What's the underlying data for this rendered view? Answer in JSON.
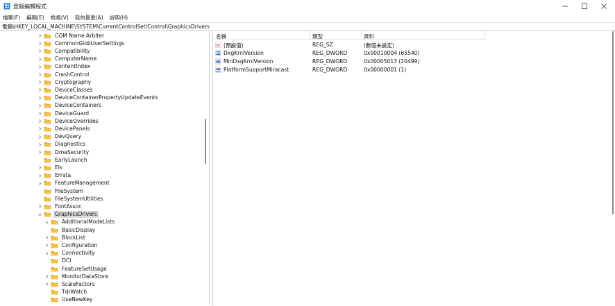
{
  "window": {
    "title": "登錄編輯程式"
  },
  "menu": [
    "檔案(F)",
    "編輯(E)",
    "檢視(V)",
    "我的最愛(A)",
    "說明(H)"
  ],
  "address": "電腦\\HKEY_LOCAL_MACHINE\\SYSTEM\\CurrentControlSet\\Control\\GraphicsDrivers",
  "tree": [
    {
      "label": "COM Name Arbiter",
      "level": 0,
      "expandable": true
    },
    {
      "label": "CommonGlobUserSettings",
      "level": 0,
      "expandable": true
    },
    {
      "label": "Compatibility",
      "level": 0,
      "expandable": true
    },
    {
      "label": "ComputerName",
      "level": 0,
      "expandable": true
    },
    {
      "label": "ContentIndex",
      "level": 0,
      "expandable": true
    },
    {
      "label": "CrashControl",
      "level": 0,
      "expandable": true
    },
    {
      "label": "Cryptography",
      "level": 0,
      "expandable": true
    },
    {
      "label": "DeviceClasses",
      "level": 0,
      "expandable": true
    },
    {
      "label": "DeviceContainerPropertyUpdateEvents",
      "level": 0,
      "expandable": true
    },
    {
      "label": "DeviceContainers",
      "level": 0,
      "expandable": true
    },
    {
      "label": "DeviceGuard",
      "level": 0,
      "expandable": true
    },
    {
      "label": "DeviceOverrides",
      "level": 0,
      "expandable": true
    },
    {
      "label": "DevicePanels",
      "level": 0,
      "expandable": true
    },
    {
      "label": "DevQuery",
      "level": 0,
      "expandable": true
    },
    {
      "label": "Diagnostics",
      "level": 0,
      "expandable": true
    },
    {
      "label": "DmaSecurity",
      "level": 0,
      "expandable": true
    },
    {
      "label": "EarlyLaunch",
      "level": 0,
      "expandable": false
    },
    {
      "label": "Els",
      "level": 0,
      "expandable": true
    },
    {
      "label": "Errata",
      "level": 0,
      "expandable": true
    },
    {
      "label": "FeatureManagement",
      "level": 0,
      "expandable": true
    },
    {
      "label": "FileSystem",
      "level": 0,
      "expandable": false
    },
    {
      "label": "FileSystemUtilities",
      "level": 0,
      "expandable": false
    },
    {
      "label": "FontAssoc",
      "level": 0,
      "expandable": true
    },
    {
      "label": "GraphicsDrivers",
      "level": 0,
      "expandable": true,
      "expanded": true,
      "selected": true
    },
    {
      "label": "AdditionalModeLists",
      "level": 1,
      "expandable": true
    },
    {
      "label": "BasicDisplay",
      "level": 1,
      "expandable": false
    },
    {
      "label": "BlockList",
      "level": 1,
      "expandable": true
    },
    {
      "label": "Configuration",
      "level": 1,
      "expandable": true
    },
    {
      "label": "Connectivity",
      "level": 1,
      "expandable": true
    },
    {
      "label": "DCI",
      "level": 1,
      "expandable": false
    },
    {
      "label": "FeatureSetUsage",
      "level": 1,
      "expandable": false
    },
    {
      "label": "MonitorDataStore",
      "level": 1,
      "expandable": true
    },
    {
      "label": "ScaleFactors",
      "level": 1,
      "expandable": true
    },
    {
      "label": "TdrWatch",
      "level": 1,
      "expandable": false
    },
    {
      "label": "UseNewKey",
      "level": 1,
      "expandable": false
    }
  ],
  "columns": {
    "name": "名稱",
    "type": "類型",
    "data": "資料"
  },
  "values": [
    {
      "icon": "string-value-icon",
      "name": "(預設值)",
      "type": "REG_SZ",
      "data": "(數值未設定)"
    },
    {
      "icon": "dword-value-icon",
      "name": "DxgKrnlVersion",
      "type": "REG_DWORD",
      "data": "0x00010004 (65540)"
    },
    {
      "icon": "dword-value-icon",
      "name": "MinDxgKrnlVersion",
      "type": "REG_DWORD",
      "data": "0x00005013 (20499)"
    },
    {
      "icon": "dword-value-icon",
      "name": "PlatformSupportMiracast",
      "type": "REG_DWORD",
      "data": "0x00000001 (1)"
    }
  ],
  "colors": {
    "folder": "#f2c04d",
    "folder_dark": "#d9a12a",
    "selection": "#d9d9d9",
    "dword_icon": "#3b6fc4",
    "string_icon": "#c0392b"
  }
}
